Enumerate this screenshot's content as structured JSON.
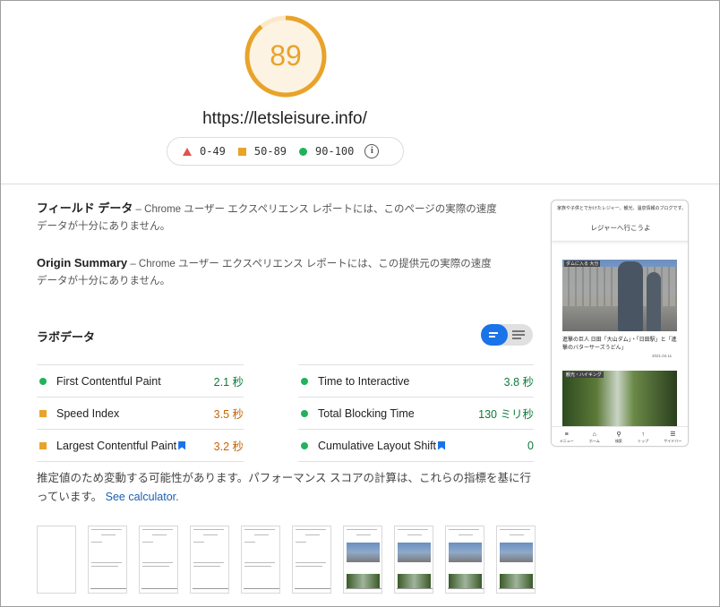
{
  "score": {
    "value": "89",
    "fraction": 0.89,
    "color": "#e8a32b",
    "url": "https://letsleisure.info/"
  },
  "legend": {
    "fail": "0-49",
    "average": "50-89",
    "pass": "90-100",
    "info_glyph": "i"
  },
  "field_data": {
    "title": "フィールド データ",
    "text": " – Chrome ユーザー エクスペリエンス レポートには、このページの実際の速度データが十分にありません。"
  },
  "origin_summary": {
    "title": "Origin Summary",
    "text": " – Chrome ユーザー エクスペリエンス レポートには、この提供元の実際の速度データが十分にありません。"
  },
  "lab_data": {
    "title": "ラボデータ",
    "metrics": [
      {
        "label": "First Contentful Paint",
        "value": "2.1 秒",
        "status": "pass"
      },
      {
        "label": "Time to Interactive",
        "value": "3.8 秒",
        "status": "pass"
      },
      {
        "label": "Speed Index",
        "value": "3.5 秒",
        "status": "average"
      },
      {
        "label": "Total Blocking Time",
        "value": "130 ミリ秒",
        "status": "pass"
      },
      {
        "label": "Largest Contentful Paint",
        "value": "3.2 秒",
        "status": "average"
      },
      {
        "label": "Cumulative Layout Shift",
        "value": "0",
        "status": "pass"
      }
    ]
  },
  "note": {
    "text": "推定値のため変動する可能性があります。パフォーマンス スコアの計算は、これらの指標を基に行っています。",
    "link": "See calculator."
  },
  "phone": {
    "tagline": "家族や子供とでかけたレジャー、観光、温泉情報のブログです。",
    "site_title": "レジャーへ行こうよ",
    "tag1": "ダムに入る 大分",
    "caption": "進撃の巨人 日田「大山ダム」・「日田駅」と「進撃のバターサーズうどん」",
    "date": "2021.04.11",
    "tag2": "観光・ハイキング",
    "nav": [
      {
        "glyph": "≡",
        "label": "メニュー"
      },
      {
        "glyph": "⌂",
        "label": "ホーム"
      },
      {
        "glyph": "⚲",
        "label": "検索"
      },
      {
        "glyph": "↑",
        "label": "トップ"
      },
      {
        "glyph": "☰",
        "label": "サイドバー"
      }
    ]
  },
  "colors": {
    "pass": "#20b35c",
    "average": "#e8a32b",
    "fail": "#e0524d",
    "accent": "#1a73e8"
  }
}
